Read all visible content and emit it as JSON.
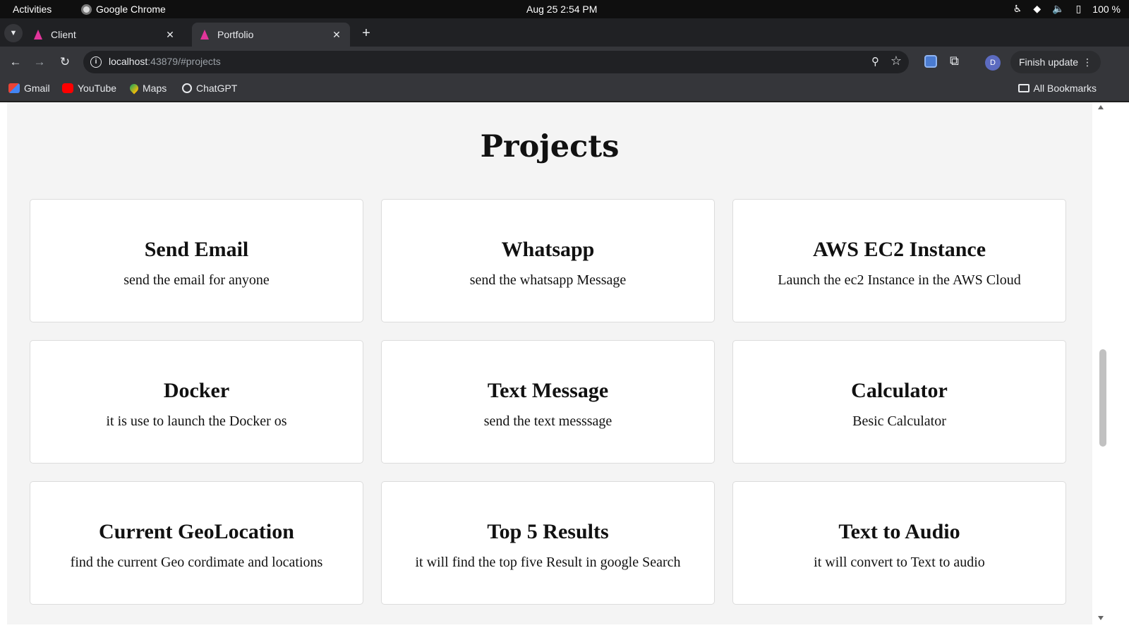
{
  "os_bar": {
    "activities": "Activities",
    "app_name": "Google Chrome",
    "clock": "Aug 25  2:54 PM",
    "battery": "100 %"
  },
  "tabs": [
    {
      "label": "Client",
      "active": false
    },
    {
      "label": "Portfolio",
      "active": true
    }
  ],
  "toolbar": {
    "url_host": "localhost",
    "url_rest": ":43879/#projects",
    "avatar_letter": "D",
    "finish_update": "Finish update"
  },
  "bookmarks": {
    "items": [
      "Gmail",
      "YouTube",
      "Maps",
      "ChatGPT"
    ],
    "all": "All Bookmarks"
  },
  "page": {
    "title": "Projects",
    "cards": [
      {
        "title": "Send Email",
        "desc": "send the email for anyone"
      },
      {
        "title": "Whatsapp",
        "desc": "send the whatsapp Message"
      },
      {
        "title": "AWS EC2 Instance",
        "desc": "Launch the ec2 Instance in the AWS Cloud"
      },
      {
        "title": "Docker",
        "desc": "it is use to launch the Docker os"
      },
      {
        "title": "Text Message",
        "desc": "send the text messsage"
      },
      {
        "title": "Calculator",
        "desc": "Besic Calculator"
      },
      {
        "title": "Current GeoLocation",
        "desc": "find the current Geo cordimate and locations"
      },
      {
        "title": "Top 5 Results",
        "desc": "it will find the top five Result in google Search"
      },
      {
        "title": "Text to Audio",
        "desc": "it will convert to Text to audio"
      }
    ]
  },
  "colors": {
    "tab_favicon": "#e2359b",
    "page_bg": "#f4f4f4",
    "card_bg": "#ffffff"
  }
}
